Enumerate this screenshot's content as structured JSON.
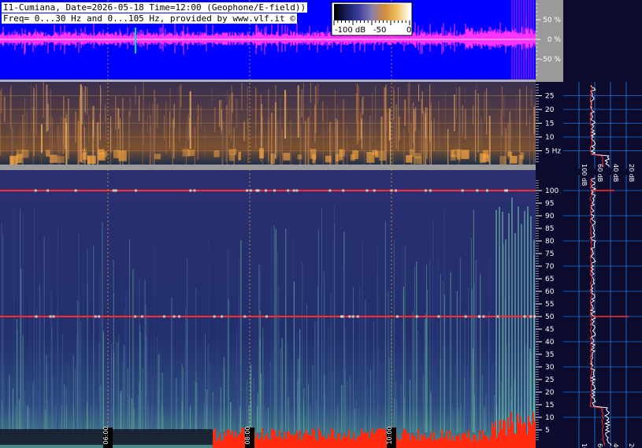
{
  "header": {
    "line1": "I1-Cumiana, Date=2026-05-18 Time=12:00 (Geophone/E-field))",
    "line2": "Freq= 0...30 Hz and 0...105 Hz, provided by www.vlf.it ©"
  },
  "colorbar": {
    "labels": [
      "-100 dB",
      "-50",
      "0"
    ],
    "stops": [
      "#000000",
      "#1b1f5e",
      "#3c3fa0",
      "#8a7fb0",
      "#d08c3a",
      "#f0c060",
      "#ffffff"
    ]
  },
  "colors": {
    "amplitude_bg": "#0000ff",
    "amplitude_trace": "#ff33ff",
    "amplitude_peak": "#00e0c0",
    "axis_panel": "#9a9a9a",
    "profile_bg": "#0b0b2e",
    "profile_grid": "#1e90ff",
    "spectrogram_bg": "#1f2a66",
    "hum_line": "#ff2a2a",
    "guide_line": "#e0a040",
    "avg_profile": "#ffffff",
    "peak_profile": "#ff3030"
  },
  "chart_data": [
    {
      "type": "line",
      "title": "",
      "ylabel": "",
      "yticks": [
        "50 %",
        "0 %",
        "-50 %"
      ],
      "ylim": [
        -100,
        100
      ],
      "note": "amplitude"
    },
    {
      "type": "heatmap",
      "ylim": [
        0,
        30
      ],
      "yticks": [
        "25",
        "20",
        "15",
        "10",
        "5 Hz"
      ],
      "bands_hz": [
        5,
        10,
        15,
        20,
        25
      ],
      "profile_xticks": [
        "100 dB",
        "60 dB",
        "40 dB",
        "20 dB"
      ]
    },
    {
      "type": "heatmap",
      "ylim": [
        0,
        105
      ],
      "yticks": [
        "100",
        "95",
        "90",
        "85",
        "80",
        "75",
        "70",
        "65",
        "60",
        "55",
        "50",
        "45",
        "40",
        "35",
        "30",
        "25",
        "20",
        "15",
        "10",
        "5"
      ],
      "hum_lines_hz": [
        50,
        100
      ],
      "time_labels": [
        "06:00",
        "08:00",
        "10:00"
      ],
      "profile_xticks": [
        "100 dB",
        "60 dB",
        "40 dB",
        "20 dB"
      ]
    }
  ]
}
